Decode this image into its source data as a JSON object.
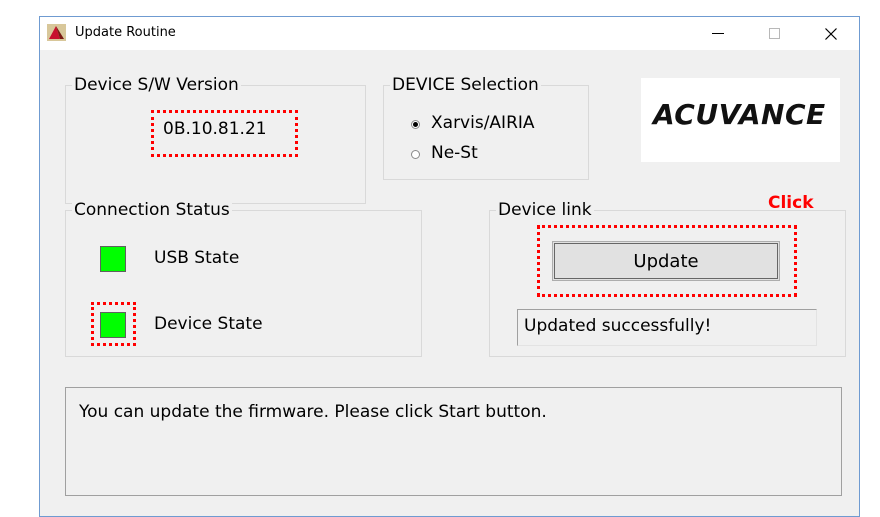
{
  "window": {
    "title": "Update Routine"
  },
  "version_group": {
    "legend": "Device S/W Version",
    "value": "0B.10.81.21"
  },
  "device_selection": {
    "legend": "DEVICE Selection",
    "options": [
      {
        "label": "Xarvis/AIRIA",
        "selected": true
      },
      {
        "label": "Ne-St",
        "selected": false
      }
    ]
  },
  "logo": {
    "text": "ACUVANCE"
  },
  "connection": {
    "legend": "Connection Status",
    "items": [
      {
        "label": "USB State",
        "color": "#00ff00"
      },
      {
        "label": "Device State",
        "color": "#00ff00"
      }
    ]
  },
  "device_link": {
    "legend": "Device link",
    "button_label": "Update",
    "status_text": "Updated successfully!",
    "annotation": "Click"
  },
  "message": {
    "text": "You can update the firmware. Please click Start button."
  }
}
